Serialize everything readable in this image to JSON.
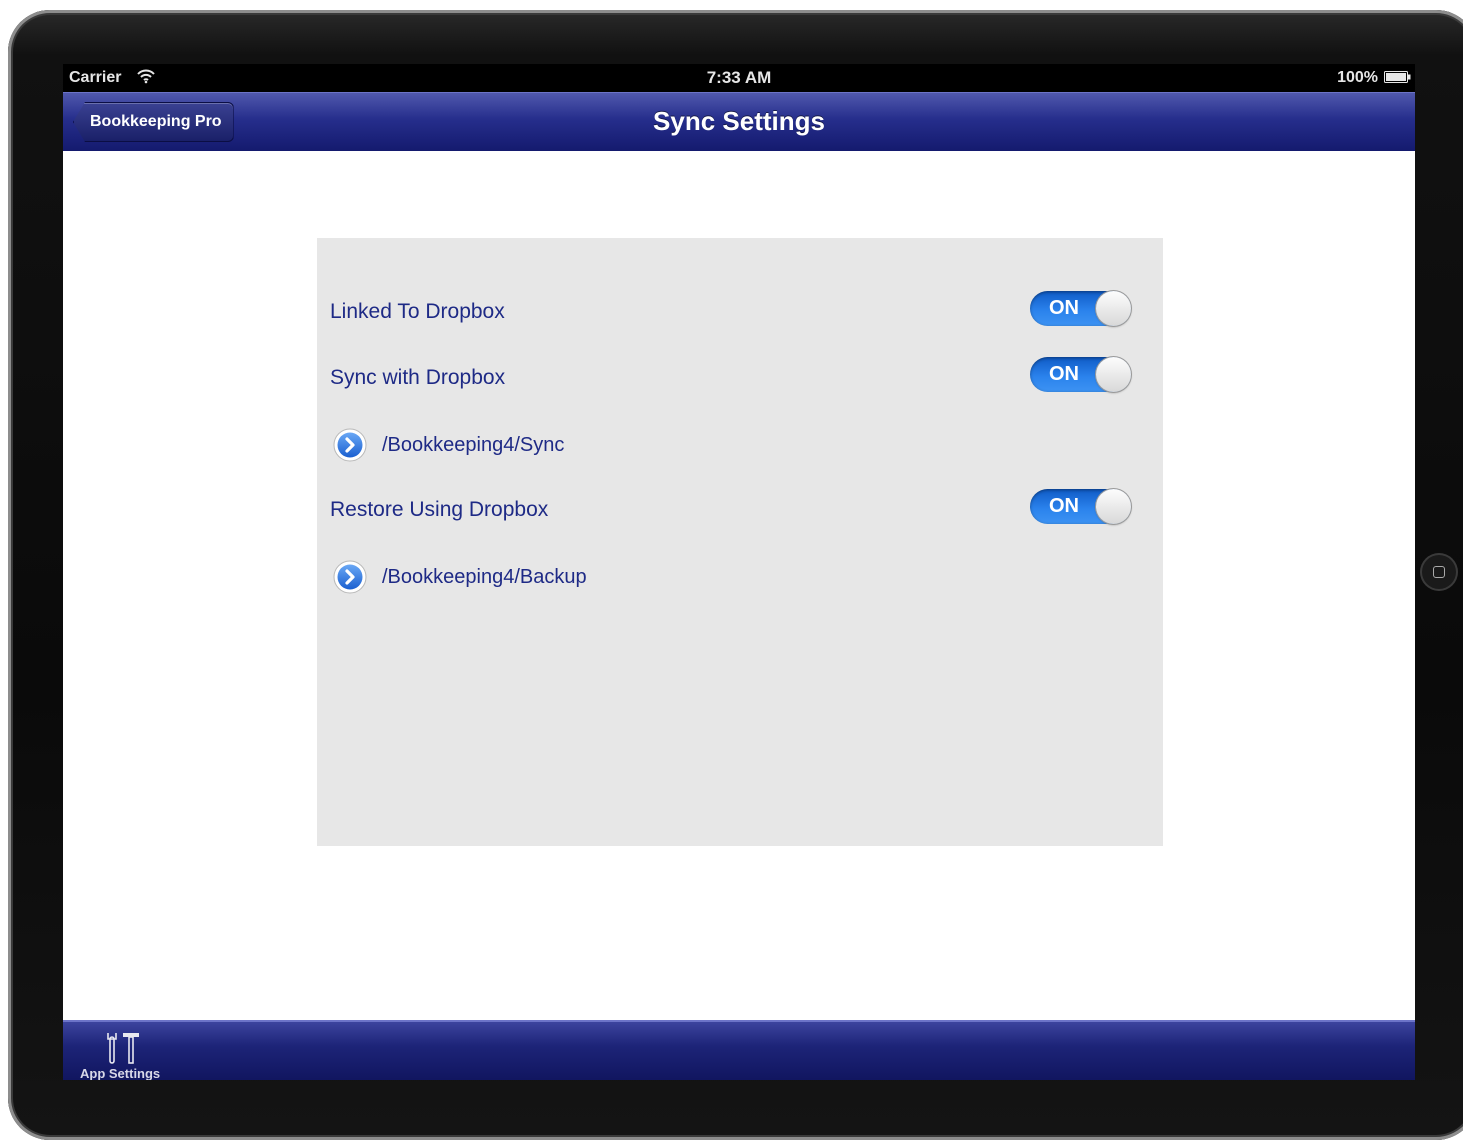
{
  "status_bar": {
    "carrier": "Carrier",
    "time": "7:33 AM",
    "battery": "100%"
  },
  "nav_bar": {
    "back_label": "Bookkeeping Pro",
    "title": "Sync Settings"
  },
  "settings": {
    "linked": {
      "label": "Linked To Dropbox",
      "state": "ON"
    },
    "sync": {
      "label": "Sync with Dropbox",
      "state": "ON",
      "path": "/Bookkeeping4/Sync"
    },
    "restore": {
      "label": "Restore Using Dropbox",
      "state": "ON",
      "path": "/Bookkeeping4/Backup"
    }
  },
  "tab_bar": {
    "items": [
      {
        "label": "App Settings",
        "icon": "tools-icon"
      }
    ]
  },
  "colors": {
    "nav_blue": "#262e8c",
    "switch_blue": "#2a82ec",
    "label_blue": "#1e2a86",
    "panel_gray": "#e7e7e7"
  }
}
